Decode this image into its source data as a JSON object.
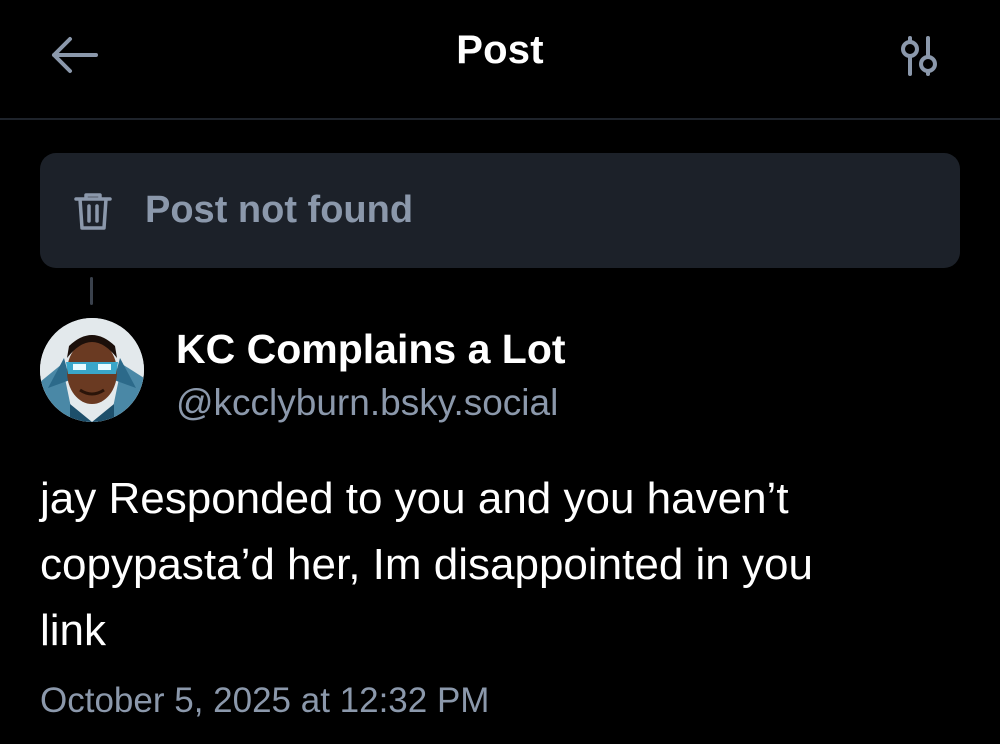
{
  "header": {
    "title": "Post",
    "back_icon": "arrow-left-icon",
    "filter_icon": "sliders-icon"
  },
  "not_found": {
    "icon": "trash-icon",
    "text": "Post not found"
  },
  "post": {
    "author_name": "KC Complains a Lot",
    "author_handle": "@kcclyburn.bsky.social",
    "text_lines": [
      "jay Responded to you and you haven’t",
      "copypasta’d her, Im disappointed in you",
      "link"
    ],
    "timestamp": "October 5, 2025 at 12:32 PM"
  },
  "colors": {
    "background": "#000000",
    "muted_text": "#8b98ab",
    "card_background": "#1c2129",
    "divider": "#1e232b"
  }
}
